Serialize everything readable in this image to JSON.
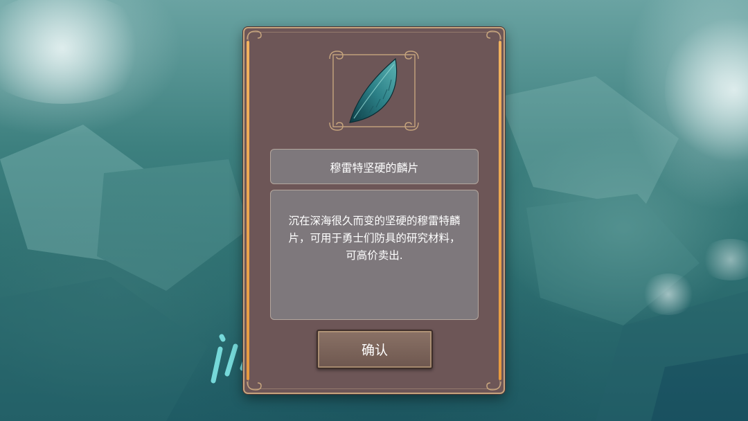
{
  "item": {
    "name": "穆雷特坚硬的麟片",
    "description": "沉在深海很久而变的坚硬的穆雷特麟片，可用于勇士们防具的研究材料，可高价卖出.",
    "icon": "scale-icon"
  },
  "dialog": {
    "confirm_label": "确认"
  },
  "colors": {
    "panel": "#6d5657",
    "border": "#c7a57e",
    "accent_bar": "#e79a3e",
    "text_box": "#8c969b"
  }
}
